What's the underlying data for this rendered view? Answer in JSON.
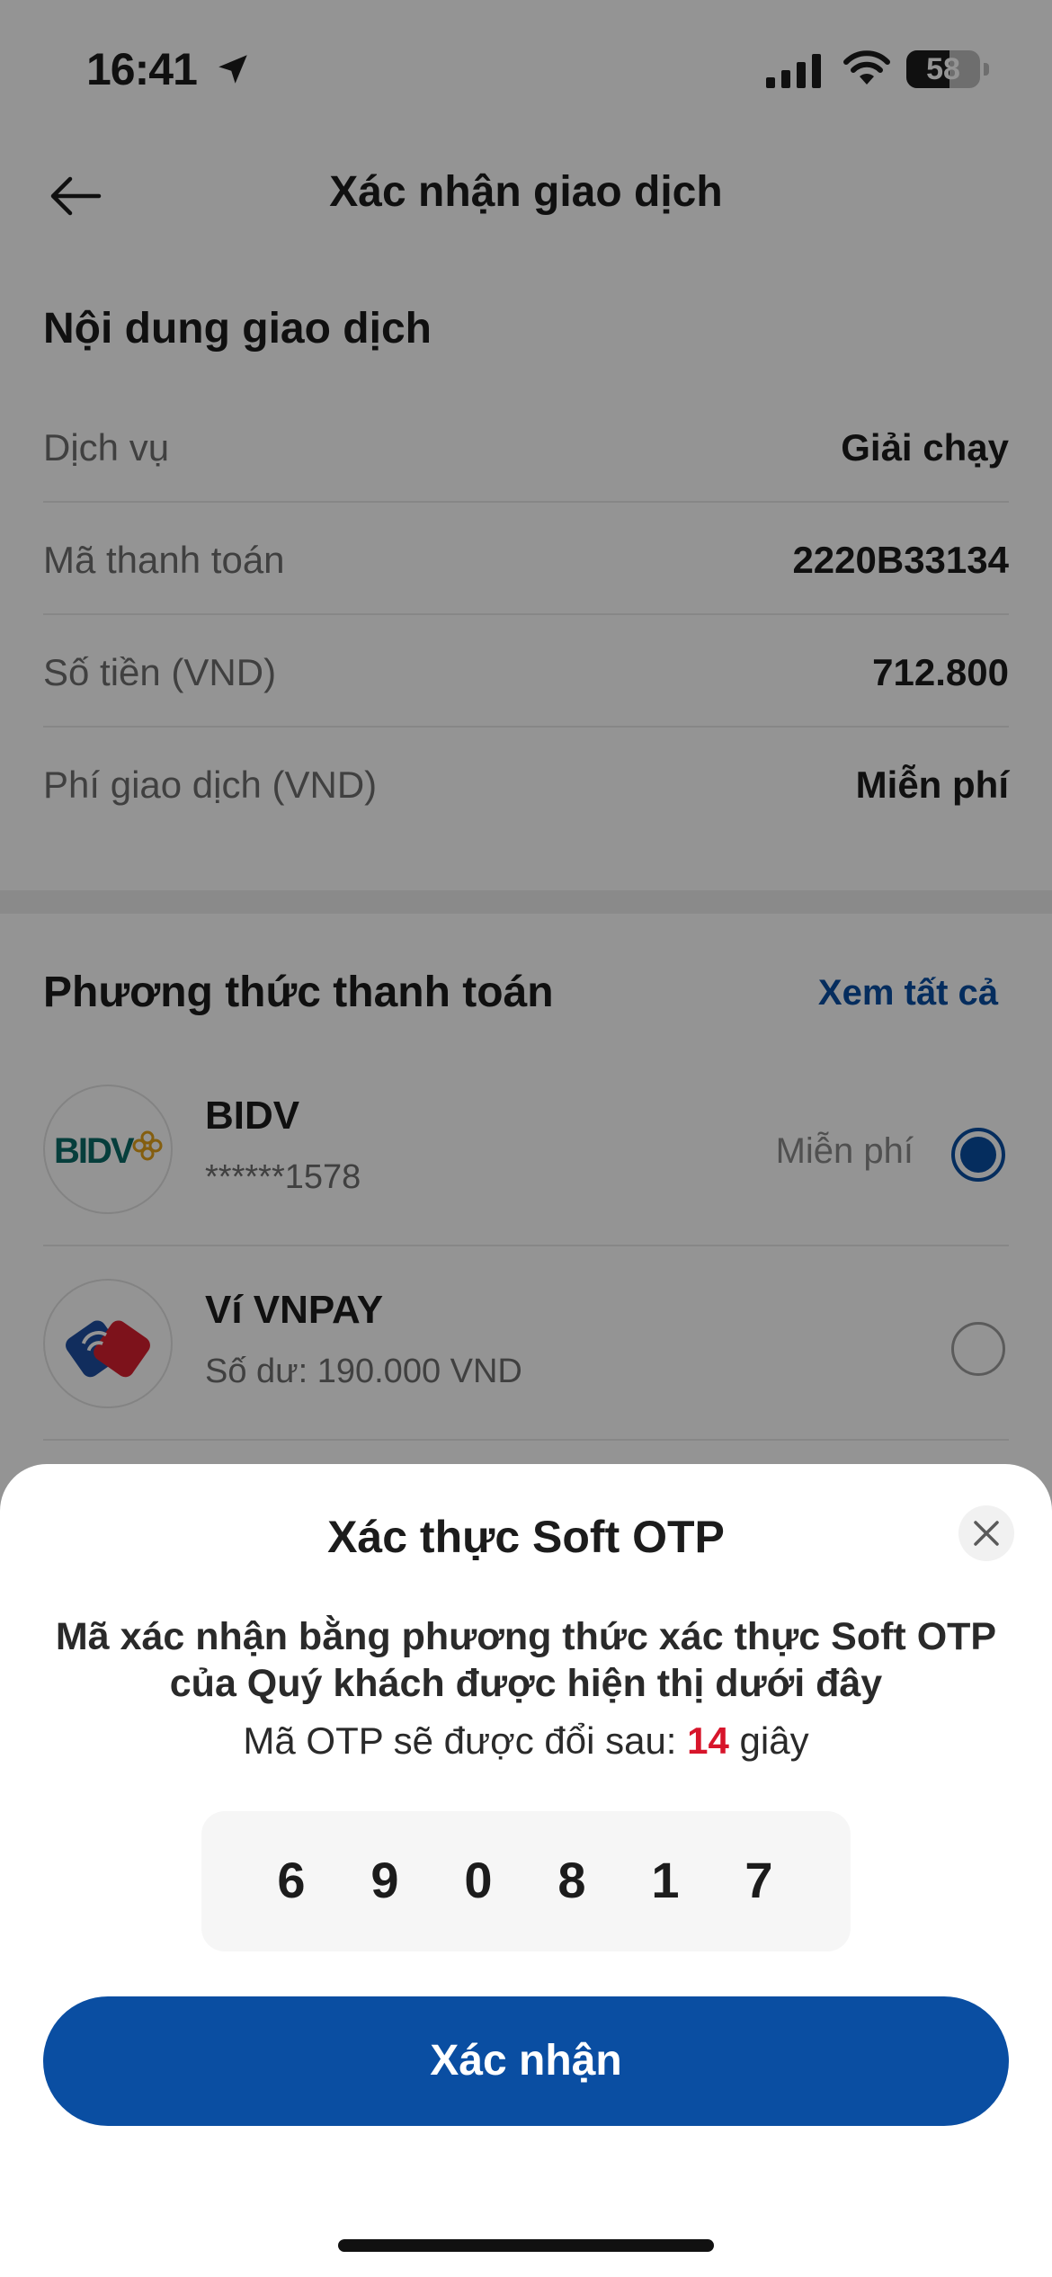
{
  "status_bar": {
    "time": "16:41",
    "battery": "58",
    "battery_level": 0.58
  },
  "header": {
    "title": "Xác nhận giao dịch"
  },
  "transaction": {
    "section_title": "Nội dung giao dịch",
    "rows": [
      {
        "label": "Dịch vụ",
        "value": "Giải chạy"
      },
      {
        "label": "Mã thanh toán",
        "value": "2220B33134"
      },
      {
        "label": "Số tiền (VND)",
        "value": "712.800"
      },
      {
        "label": "Phí giao dịch (VND)",
        "value": "Miễn phí"
      }
    ]
  },
  "payment": {
    "section_title": "Phương thức thanh toán",
    "see_all": "Xem tất cả",
    "methods": [
      {
        "name": "BIDV",
        "sub": "******1578",
        "fee": "Miễn phí",
        "logo_text": "BIDV",
        "selected": true
      },
      {
        "name": "Ví VNPAY",
        "sub": "Số dư: 190.000 VND",
        "fee": "",
        "selected": false
      }
    ]
  },
  "sheet": {
    "title": "Xác thực Soft OTP",
    "description": "Mã xác nhận bằng phương thức xác thực Soft OTP của Quý khách được hiện thị dưới đây",
    "countdown_prefix": "Mã OTP sẽ được đổi sau:",
    "countdown_value": "14",
    "countdown_unit": "giây",
    "otp_digits": [
      "6",
      "9",
      "0",
      "8",
      "1",
      "7"
    ],
    "confirm_label": "Xác nhận"
  },
  "colors": {
    "accent": "#0a4ea2",
    "countdown": "#d7152b"
  }
}
